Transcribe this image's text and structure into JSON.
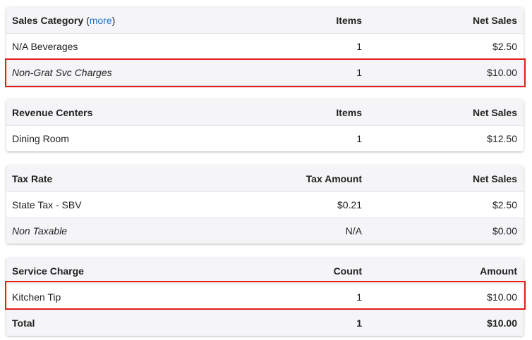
{
  "sales_category": {
    "header": {
      "col1": "Sales Category",
      "more_open": "(",
      "more_link": "more",
      "more_close": ")",
      "col2": "Items",
      "col3": "Net Sales"
    },
    "rows": [
      {
        "name": "N/A Beverages",
        "items": "1",
        "net_sales": "$2.50"
      },
      {
        "name": "Non-Grat Svc Charges",
        "items": "1",
        "net_sales": "$10.00"
      }
    ]
  },
  "revenue_centers": {
    "header": {
      "col1": "Revenue Centers",
      "col2": "Items",
      "col3": "Net Sales"
    },
    "rows": [
      {
        "name": "Dining Room",
        "items": "1",
        "net_sales": "$12.50"
      }
    ]
  },
  "tax_rate": {
    "header": {
      "col1": "Tax Rate",
      "col2": "Tax Amount",
      "col3": "Net Sales"
    },
    "rows": [
      {
        "name": "State Tax - SBV",
        "tax_amount": "$0.21",
        "net_sales": "$2.50"
      },
      {
        "name": "Non Taxable",
        "tax_amount": "N/A",
        "net_sales": "$0.00"
      }
    ]
  },
  "service_charge": {
    "header": {
      "col1": "Service Charge",
      "col2": "Count",
      "col3": "Amount"
    },
    "rows": [
      {
        "name": "Kitchen Tip",
        "count": "1",
        "amount": "$10.00"
      }
    ],
    "total": {
      "label": "Total",
      "count": "1",
      "amount": "$10.00"
    }
  },
  "colors": {
    "highlight": "#e0201c",
    "link": "#1a73c9",
    "header_bg": "#f5f5f7"
  }
}
